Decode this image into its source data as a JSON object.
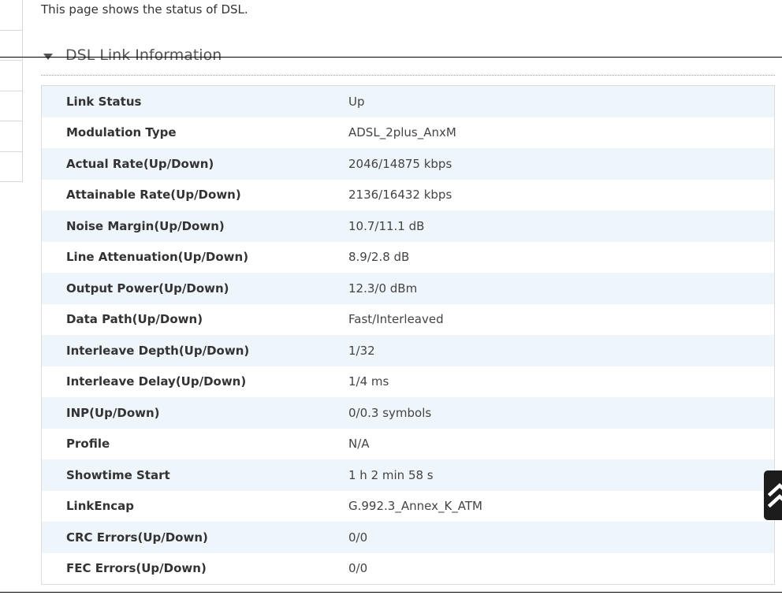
{
  "intro": {
    "text": "This page shows the status of DSL."
  },
  "section": {
    "title": "DSL Link Information",
    "collapse_icon": "triangle-down-icon"
  },
  "table": {
    "rows": [
      {
        "label": "Link Status",
        "value": "Up"
      },
      {
        "label": "Modulation Type",
        "value": "ADSL_2plus_AnxM"
      },
      {
        "label": "Actual Rate(Up/Down)",
        "value": "2046/14875 kbps"
      },
      {
        "label": "Attainable Rate(Up/Down)",
        "value": "2136/16432 kbps"
      },
      {
        "label": "Noise Margin(Up/Down)",
        "value": "10.7/11.1 dB"
      },
      {
        "label": "Line Attenuation(Up/Down)",
        "value": "8.9/2.8 dB"
      },
      {
        "label": "Output Power(Up/Down)",
        "value": "12.3/0 dBm"
      },
      {
        "label": "Data Path(Up/Down)",
        "value": "Fast/Interleaved"
      },
      {
        "label": "Interleave Depth(Up/Down)",
        "value": "1/32"
      },
      {
        "label": "Interleave Delay(Up/Down)",
        "value": "1/4 ms"
      },
      {
        "label": "INP(Up/Down)",
        "value": "0/0.3 symbols"
      },
      {
        "label": "Profile",
        "value": "N/A"
      },
      {
        "label": "Showtime Start",
        "value": "1 h 2 min 58 s"
      },
      {
        "label": "LinkEncap",
        "value": "G.992.3_Annex_K_ATM"
      },
      {
        "label": "CRC Errors(Up/Down)",
        "value": "0/0"
      },
      {
        "label": "FEC Errors(Up/Down)",
        "value": "0/0"
      }
    ]
  },
  "scroll_top": {
    "icon": "double-chevron-up-icon"
  },
  "colors": {
    "row_alt": "#eef5fb",
    "button_bg": "#1c1c1c",
    "label_text": "#333333"
  }
}
